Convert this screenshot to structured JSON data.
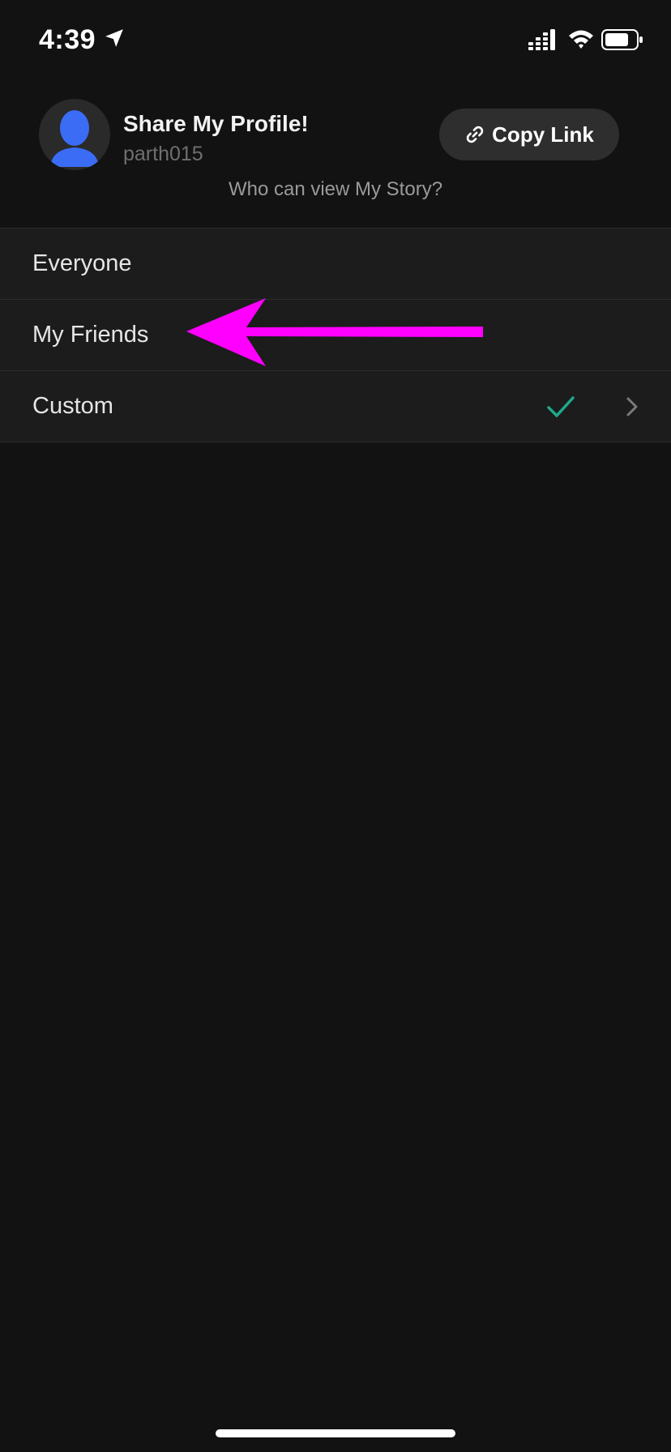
{
  "status_bar": {
    "time": "4:39"
  },
  "header": {
    "title": "Share My Profile!",
    "username": "parth015",
    "copy_link_label": "Copy Link",
    "caption": "Who can view My Story?"
  },
  "options": [
    {
      "label": "Everyone",
      "selected": false
    },
    {
      "label": "My Friends",
      "selected": false
    },
    {
      "label": "Custom",
      "selected": true
    }
  ],
  "colors": {
    "background": "#121212",
    "row_background": "#1c1c1c",
    "check_accent": "#1fa88a",
    "annotation_arrow": "#ff00ff",
    "avatar_blue": "#3b6cf6"
  },
  "icons": {
    "location": "location-arrow-icon",
    "signal": "cellular-signal-icon",
    "wifi": "wifi-icon",
    "battery": "battery-icon",
    "link": "link-icon",
    "check": "checkmark-icon",
    "chevron": "chevron-right-icon"
  }
}
